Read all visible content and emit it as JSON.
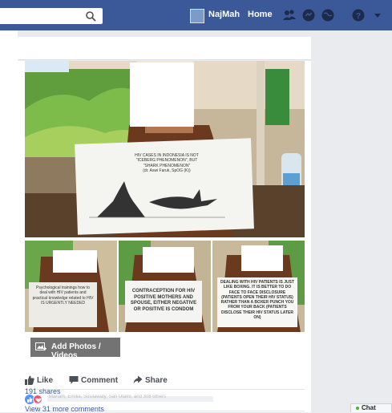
{
  "header": {
    "search_placeholder": "",
    "profile_name": "NajMah",
    "home_label": "Home"
  },
  "post": {
    "main_sign": {
      "lines": [
        "HIV CASES IN INDONESIA IS NOT",
        "\"ICEBERG PHENOMENON\", BUT",
        "\"SHARK PHENOMENON\"",
        "(dr. Aswi Faruk, SpOG (K))"
      ]
    },
    "thumb_signs": [
      {
        "text": "Psychological trainings how to deal with HIV patients and practical knowledge related to HIV IS URGENTLY NEEDED"
      },
      {
        "text": "CONTRACEPTION FOR HIV POSITIVE MOTHERS AND SPOUSE, EITHER NEGATIVE OR POSITIVE IS CONDOM"
      },
      {
        "text": "DEALING WITH HIV PATIENTS IS JUST LIKE BOXING. IT IS BETTER TO DO FACE TO FACE DISCLOSURE (PATIENTS OPEN THEIR HIV STATUS) RATHER THAN A BOXER PUNCH YOU FROM YOUR BACK (PATIENTS DISCLOSE THEIR HIV STATUS LATER ON)"
      }
    ],
    "add_photos_label": "Add Photos / Videos",
    "actions": {
      "like": "Like",
      "comment": "Comment",
      "share": "Share"
    },
    "reaction_names": "Mariam, Emilia, Susilawaty, Sari Utami, and 308 others",
    "shares": "191 shares",
    "more_comments": "View 31 more comments"
  },
  "chat": {
    "label": "Chat"
  },
  "colors": {
    "brand_blue": "#3b5998",
    "link_blue": "#365899",
    "background": "#e9ebee",
    "online_green": "#42b72a"
  },
  "icons": [
    "search-icon",
    "friends-icon",
    "messages-icon",
    "globe-icon",
    "help-icon",
    "caret-down-icon",
    "camera-icon",
    "like-icon",
    "comment-icon",
    "share-icon",
    "like-reaction-icon",
    "love-reaction-icon"
  ]
}
